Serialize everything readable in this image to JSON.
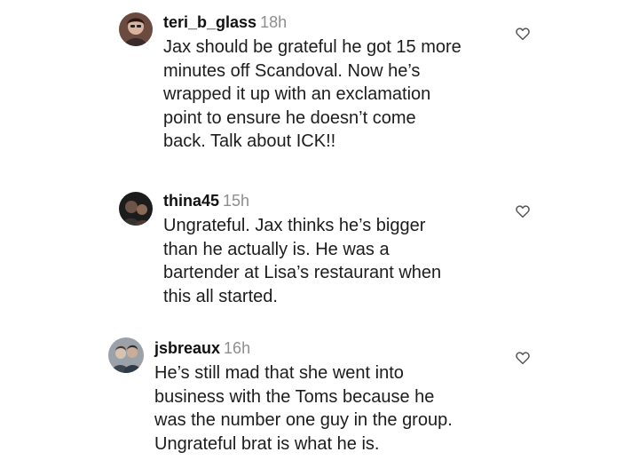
{
  "comments": [
    {
      "username": "teri_b_glass",
      "time": "18h",
      "text": "Jax should be grateful he got 15 more\nminutes off Scandoval. Now he’s\nwrapped it up with an exclamation\npoint to ensure he doesn’t come\nback. Talk about ICK!!"
    },
    {
      "username": "thina45",
      "time": "15h",
      "text": "Ungrateful.  Jax thinks he’s bigger\nthan he actually is.  He was a\nbartender at Lisa’s restaurant when\nthis all started."
    },
    {
      "username": "jsbreaux",
      "time": "16h",
      "text": "He’s still mad that she went into\nbusiness with the Toms because he\nwas the number one guy in the group.\nUngrateful brat is what he is."
    }
  ],
  "icons": {
    "like": "heart-outline-icon"
  }
}
